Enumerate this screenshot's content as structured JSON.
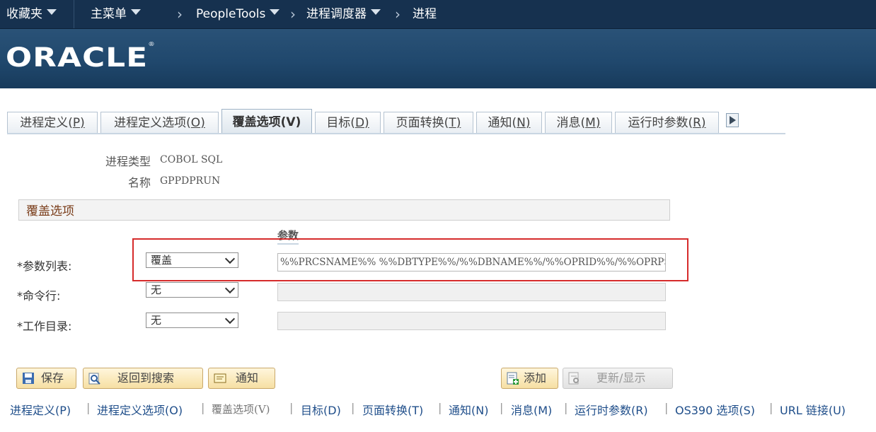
{
  "nav": {
    "favorites": "收藏夹",
    "main_menu": "主菜单",
    "crumbs": [
      "PeopleTools",
      "进程调度器",
      "进程"
    ]
  },
  "brand": {
    "logo": "ORACLE",
    "mark": "®"
  },
  "tabs": [
    {
      "label": "进程定义(",
      "key": "P",
      "end": ")"
    },
    {
      "label": "进程定义选项(",
      "key": "O",
      "end": ")"
    },
    {
      "label": "覆盖选项(V)",
      "active": true
    },
    {
      "label": "目标(",
      "key": "D",
      "end": ")"
    },
    {
      "label": "页面转换(",
      "key": "T",
      "end": ")"
    },
    {
      "label": "通知(",
      "key": "N",
      "end": ")"
    },
    {
      "label": "消息(",
      "key": "M",
      "end": ")"
    },
    {
      "label": "运行时参数(",
      "key": "R",
      "end": ")"
    }
  ],
  "info": {
    "process_type_label": "进程类型",
    "process_type_value": "COBOL SQL",
    "name_label": "名称",
    "name_value": "GPPDPRUN"
  },
  "group": {
    "title": "覆盖选项",
    "param_column": "参数"
  },
  "rows": [
    {
      "label": "*参数列表:",
      "select": "覆盖",
      "value": "%%PRCSNAME%% %%DBTYPE%%/%%DBNAME%%/%%OPRID%%/%%OPRPSWD%%/%%R"
    },
    {
      "label": "*命令行:",
      "select": "无",
      "value": ""
    },
    {
      "label": "*工作目录:",
      "select": "无",
      "value": ""
    }
  ],
  "buttons": {
    "save": "保存",
    "return": "返回到搜索",
    "notify": "通知",
    "add": "添加",
    "update": "更新/显示"
  },
  "footer_links": [
    "进程定义(P)",
    "进程定义选项(O)",
    "覆盖选项(V)",
    "目标(D)",
    "页面转换(T)",
    "通知(N)",
    "消息(M)",
    "运行时参数(R)",
    "OS390 选项(S)",
    "URL 链接(U)"
  ],
  "colors": {
    "nav_bg": "#16314f",
    "banner_bg": "#20486d",
    "highlight": "#d62b2b",
    "link": "#1f4e8a"
  }
}
